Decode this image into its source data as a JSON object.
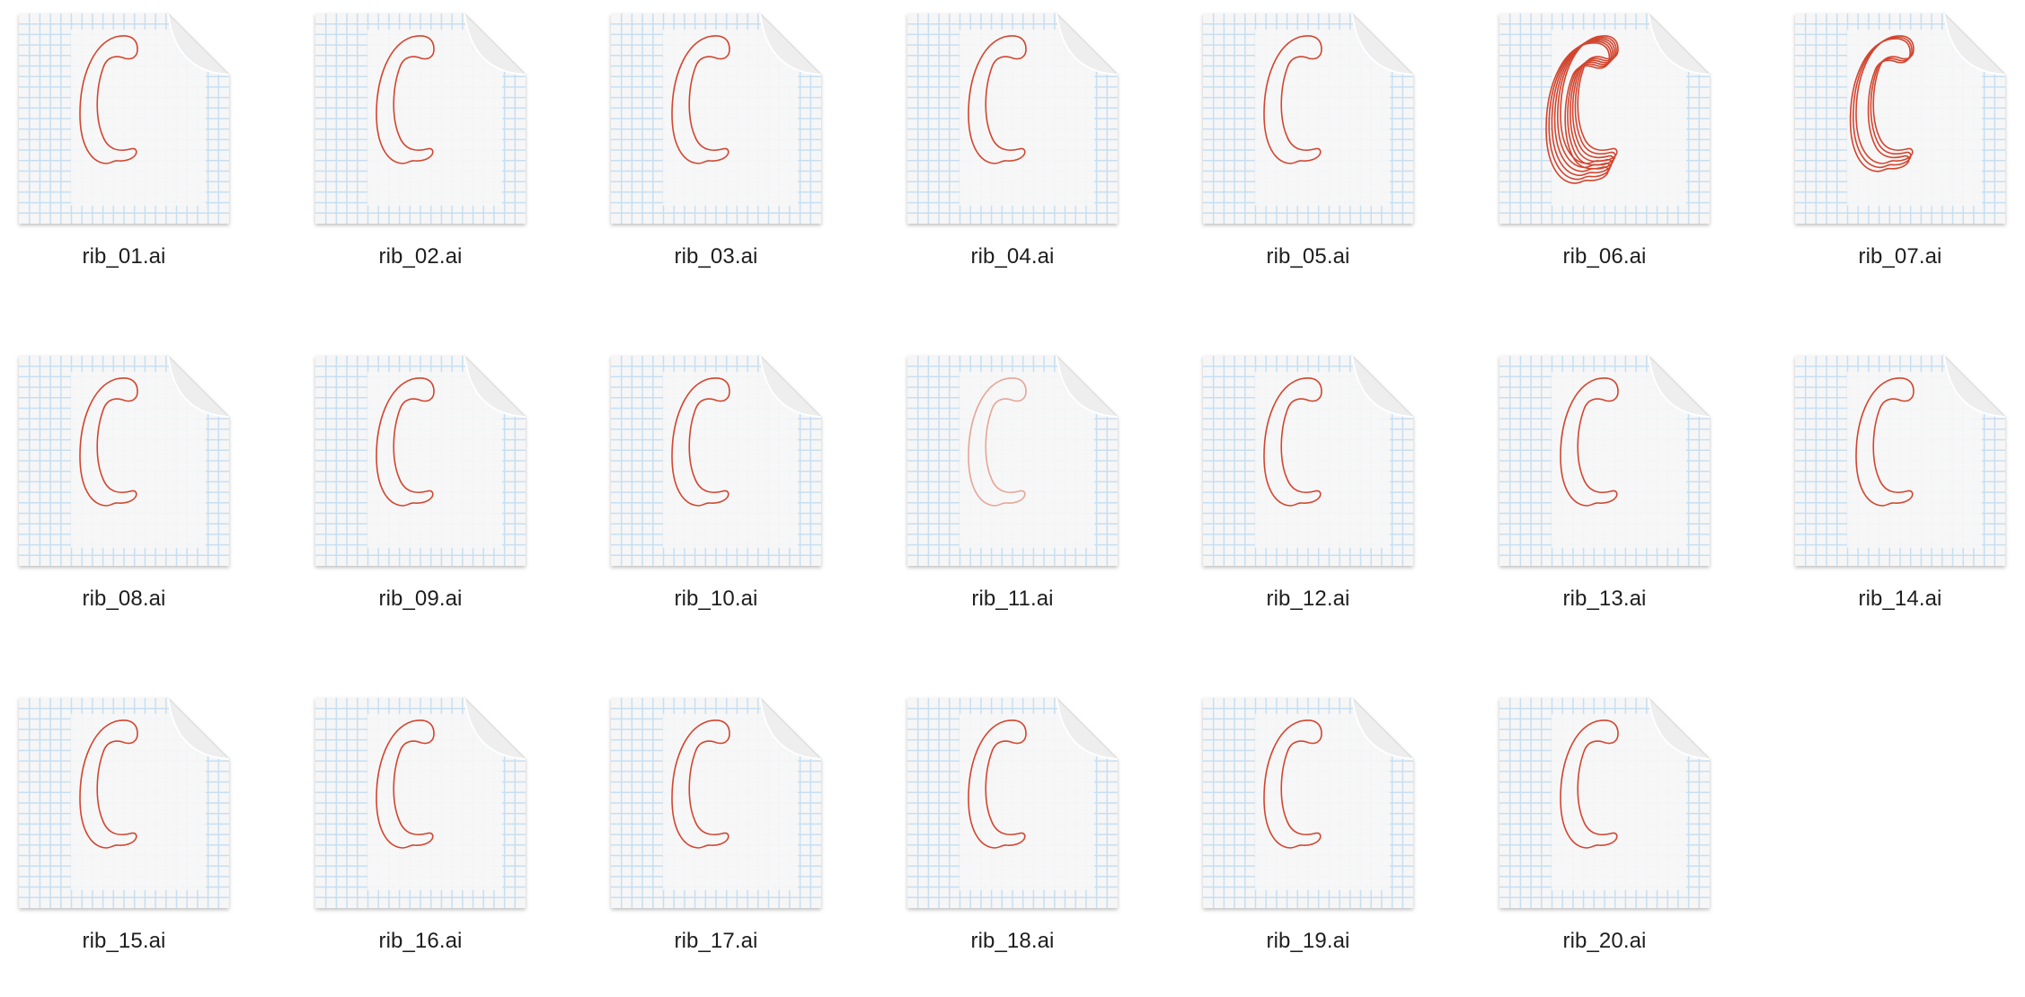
{
  "window": {
    "view": "icon-view",
    "item_kind": "Adobe Illustrator document"
  },
  "colors": {
    "background": "#ffffff",
    "doc_paper": "#f6f6f6",
    "doc_grid": "#c6dff2",
    "doc_fold": "#eeeeee",
    "stroke": "#d2452f",
    "stroke_faint": "#e6a597",
    "label_text": "#1e1e1e"
  },
  "files": [
    {
      "name": "rib_01.ai",
      "icon": "illustrator-document-thumbnail-icon",
      "outline_count": 1,
      "faint": false
    },
    {
      "name": "rib_02.ai",
      "icon": "illustrator-document-thumbnail-icon",
      "outline_count": 1,
      "faint": false
    },
    {
      "name": "rib_03.ai",
      "icon": "illustrator-document-thumbnail-icon",
      "outline_count": 1,
      "faint": false
    },
    {
      "name": "rib_04.ai",
      "icon": "illustrator-document-thumbnail-icon",
      "outline_count": 1,
      "faint": false
    },
    {
      "name": "rib_05.ai",
      "icon": "illustrator-document-thumbnail-icon",
      "outline_count": 1,
      "faint": false
    },
    {
      "name": "rib_06.ai",
      "icon": "illustrator-document-thumbnail-icon",
      "outline_count": 6,
      "faint": false
    },
    {
      "name": "rib_07.ai",
      "icon": "illustrator-document-thumbnail-icon",
      "outline_count": 3,
      "faint": false
    },
    {
      "name": "rib_08.ai",
      "icon": "illustrator-document-thumbnail-icon",
      "outline_count": 1,
      "faint": false
    },
    {
      "name": "rib_09.ai",
      "icon": "illustrator-document-thumbnail-icon",
      "outline_count": 1,
      "faint": false
    },
    {
      "name": "rib_10.ai",
      "icon": "illustrator-document-thumbnail-icon",
      "outline_count": 1,
      "faint": false
    },
    {
      "name": "rib_11.ai",
      "icon": "illustrator-document-thumbnail-icon",
      "outline_count": 1,
      "faint": true
    },
    {
      "name": "rib_12.ai",
      "icon": "illustrator-document-thumbnail-icon",
      "outline_count": 1,
      "faint": false
    },
    {
      "name": "rib_13.ai",
      "icon": "illustrator-document-thumbnail-icon",
      "outline_count": 1,
      "faint": false
    },
    {
      "name": "rib_14.ai",
      "icon": "illustrator-document-thumbnail-icon",
      "outline_count": 1,
      "faint": false
    },
    {
      "name": "rib_15.ai",
      "icon": "illustrator-document-thumbnail-icon",
      "outline_count": 1,
      "faint": false
    },
    {
      "name": "rib_16.ai",
      "icon": "illustrator-document-thumbnail-icon",
      "outline_count": 1,
      "faint": false
    },
    {
      "name": "rib_17.ai",
      "icon": "illustrator-document-thumbnail-icon",
      "outline_count": 1,
      "faint": false
    },
    {
      "name": "rib_18.ai",
      "icon": "illustrator-document-thumbnail-icon",
      "outline_count": 1,
      "faint": false
    },
    {
      "name": "rib_19.ai",
      "icon": "illustrator-document-thumbnail-icon",
      "outline_count": 1,
      "faint": false
    },
    {
      "name": "rib_20.ai",
      "icon": "illustrator-document-thumbnail-icon",
      "outline_count": 1,
      "faint": false
    }
  ]
}
